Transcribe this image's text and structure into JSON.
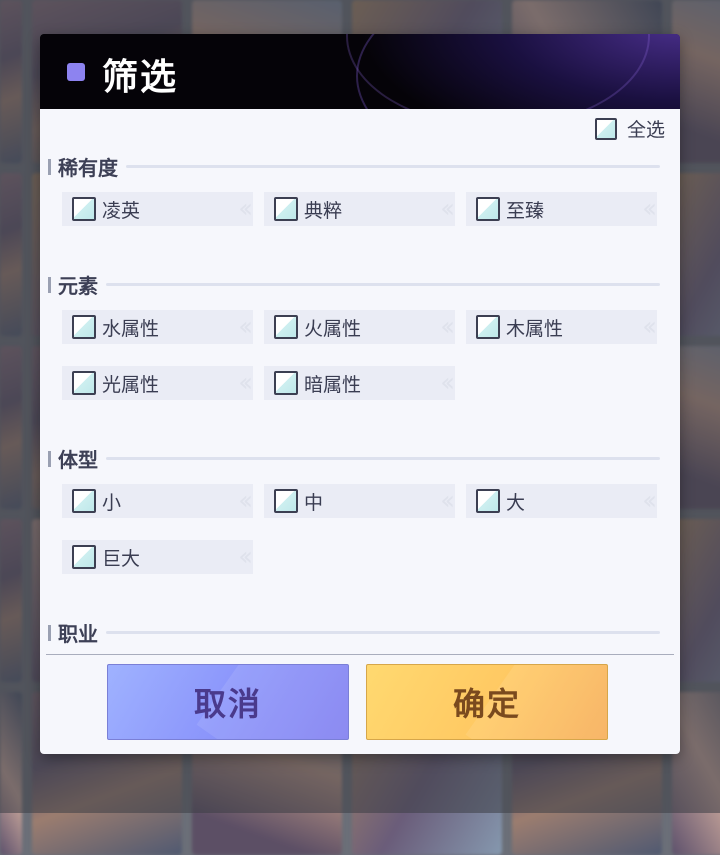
{
  "dialog": {
    "title": "筛选",
    "select_all_label": "全选",
    "accent_color": "#8d83f0",
    "cancel_label": "取消",
    "confirm_label": "确定"
  },
  "sections": [
    {
      "title": "稀有度",
      "options": [
        "凌英",
        "典粹",
        "至臻"
      ]
    },
    {
      "title": "元素",
      "options": [
        "水属性",
        "火属性",
        "木属性",
        "光属性",
        "暗属性"
      ]
    },
    {
      "title": "体型",
      "options": [
        "小",
        "中",
        "大",
        "巨大"
      ]
    },
    {
      "title": "职业",
      "options": []
    }
  ],
  "checked": {
    "select_all": false,
    "all_options": false
  }
}
